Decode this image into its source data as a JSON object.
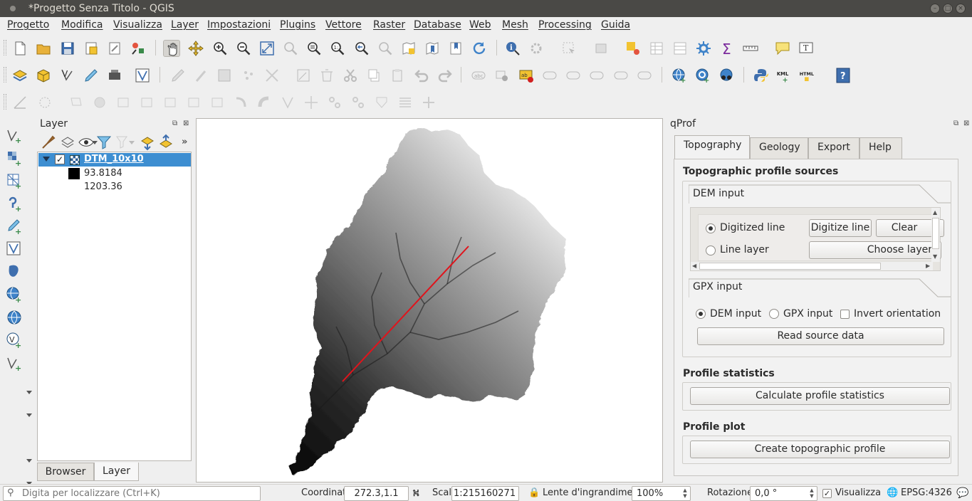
{
  "window": {
    "title": "*Progetto Senza Titolo - QGIS"
  },
  "menu": [
    "Progetto",
    "Modifica",
    "Visualizza",
    "Layer",
    "Impostazioni",
    "Plugins",
    "Vettore",
    "Raster",
    "Database",
    "Web",
    "Mesh",
    "Processing",
    "Guida"
  ],
  "layer_panel": {
    "title": "Layer",
    "layer_name": "DTM_10x10",
    "legend_min": "93.8184",
    "legend_max": "1203.36",
    "tabs": [
      "Browser",
      "Layer"
    ],
    "active_tab": "Layer"
  },
  "qprof": {
    "title": "qProf",
    "tabs": [
      "Topography",
      "Geology",
      "Export",
      "Help"
    ],
    "active_tab": "Topography",
    "sources_header": "Topographic profile sources",
    "dem_group": "DEM input",
    "digitized_line_label": "Digitized line",
    "digitize_button": "Digitize line",
    "clear_button": "Clear",
    "line_layer_label": "Line layer",
    "choose_layer_button": "Choose layer",
    "gpx_group": "GPX input",
    "dem_input_radio": "DEM input",
    "gpx_input_radio": "GPX input",
    "invert_orientation": "Invert orientation",
    "read_source_button": "Read source data",
    "stats_header": "Profile statistics",
    "stats_button": "Calculate profile statistics",
    "plot_header": "Profile plot",
    "plot_button": "Create topographic profile"
  },
  "toolbar": {
    "kml_label": "KML",
    "html_label": "HTML"
  },
  "statusbar": {
    "locator_placeholder": "Digita per localizzare (Ctrl+K)",
    "coordinate_label": "Coordinate",
    "coordinate_value": "272.3,1.1",
    "scale_label": "Scala",
    "scale_value": "1:215160271",
    "magnifier_label": "Lente d'ingrandimento",
    "magnifier_value": "100%",
    "rotation_label": "Rotazione",
    "rotation_value": "0,0 °",
    "render_label": "Visualizza",
    "crs_label": "EPSG:4326"
  },
  "colors": {
    "selection": "#3d8ed1",
    "profile_line": "#e0141c",
    "titlebar": "#4a4946"
  }
}
